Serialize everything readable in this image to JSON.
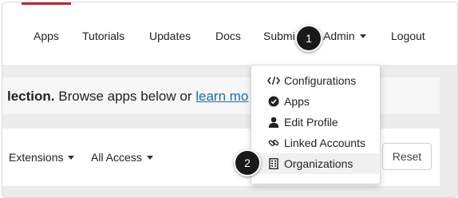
{
  "colors": {
    "accent": "#c0262d",
    "link": "#1f6ea5",
    "badge": "#1a1a1a"
  },
  "nav": {
    "items": [
      {
        "label": "Apps"
      },
      {
        "label": "Tutorials"
      },
      {
        "label": "Updates"
      },
      {
        "label": "Docs"
      },
      {
        "label": "Submi"
      }
    ],
    "admin_label": "Admin",
    "logout_label": "Logout"
  },
  "banner": {
    "bold_text": "lection.",
    "text": " Browse apps below or ",
    "link_text": "learn mo"
  },
  "filters": {
    "extensions_label": "Extensions",
    "access_label": "All Access",
    "reset_label": "Reset"
  },
  "admin_menu": {
    "items": [
      {
        "label": "Configurations",
        "icon": "code-icon"
      },
      {
        "label": "Apps",
        "icon": "apps-badge-icon"
      },
      {
        "label": "Edit Profile",
        "icon": "user-icon"
      },
      {
        "label": "Linked Accounts",
        "icon": "link-icon"
      },
      {
        "label": "Organizations",
        "icon": "building-icon"
      }
    ]
  },
  "callouts": {
    "first": "1",
    "second": "2"
  }
}
